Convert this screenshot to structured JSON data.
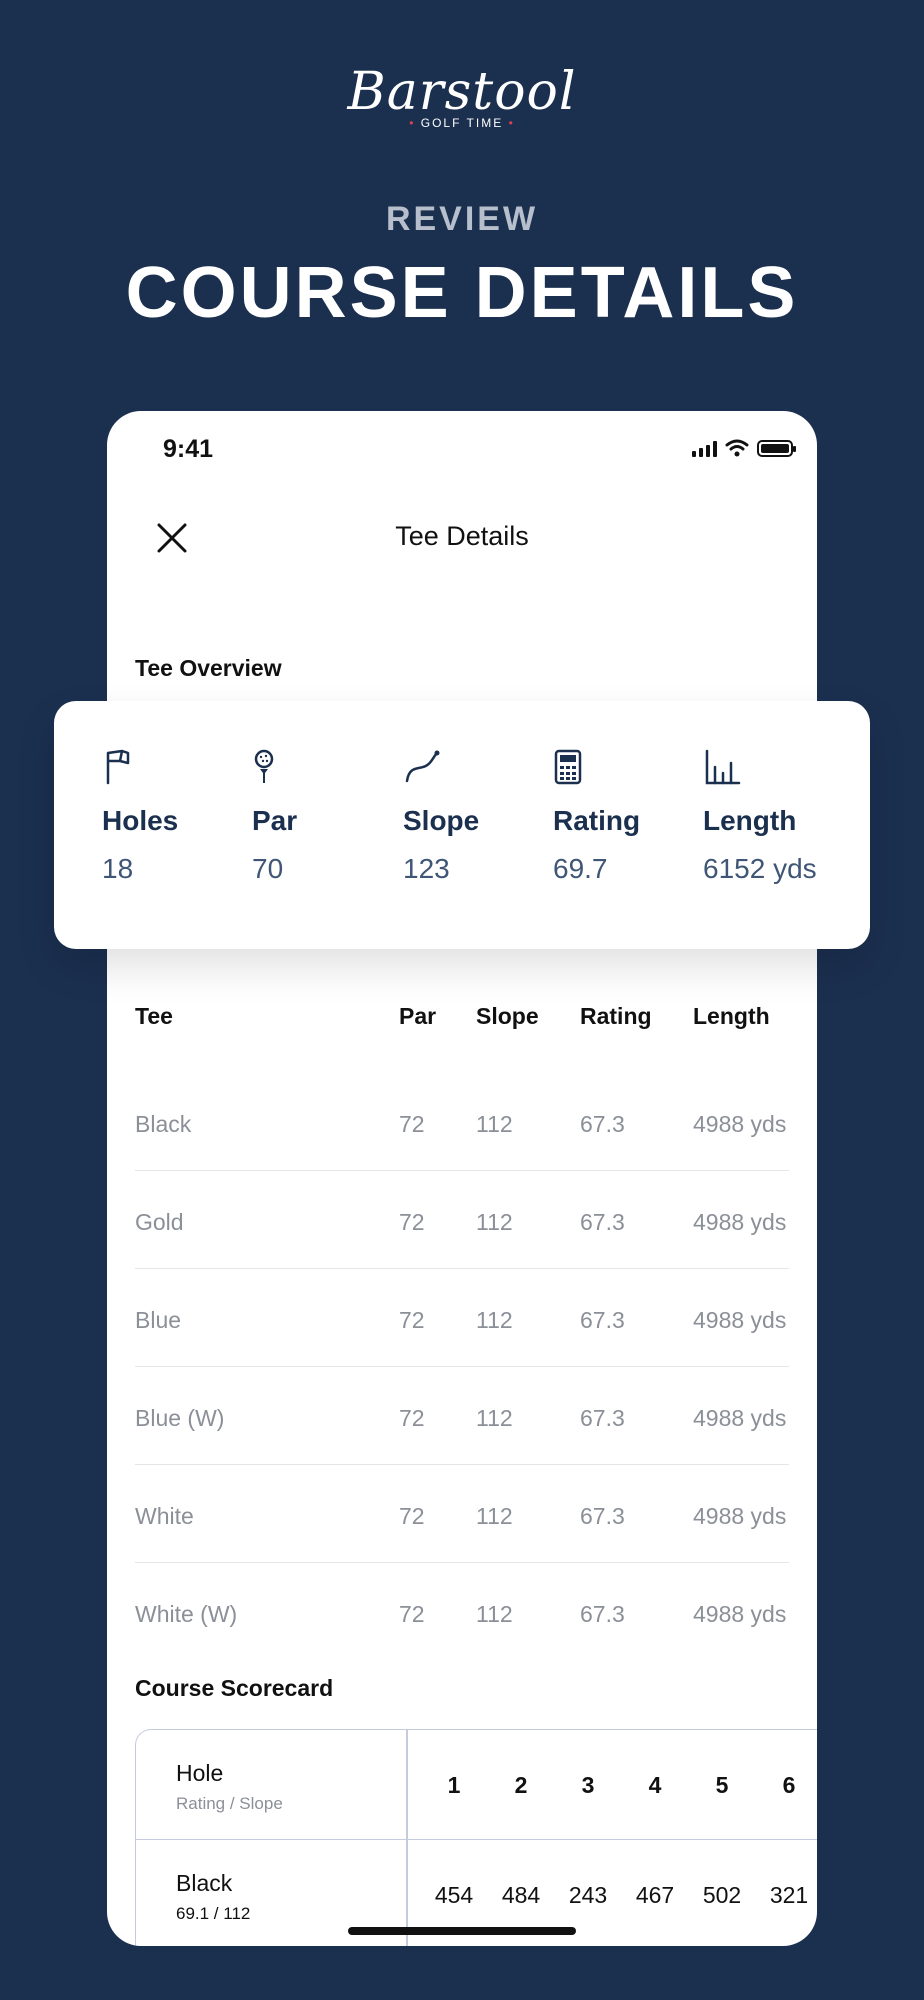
{
  "brand": {
    "script": "Barstool",
    "sub": "GOLF TIME"
  },
  "promo": {
    "eyebrow": "REVIEW",
    "headline": "COURSE DETAILS"
  },
  "status_bar": {
    "time": "9:41"
  },
  "nav": {
    "title": "Tee Details",
    "close_icon": "close-icon"
  },
  "sections": {
    "overview": "Tee Overview",
    "scorecard": "Course Scorecard"
  },
  "overview": [
    {
      "icon": "flag-icon",
      "label": "Holes",
      "value": "18"
    },
    {
      "icon": "golf-ball-tee-icon",
      "label": "Par",
      "value": "70"
    },
    {
      "icon": "slope-curve-icon",
      "label": "Slope",
      "value": "123"
    },
    {
      "icon": "calculator-icon",
      "label": "Rating",
      "value": "69.7"
    },
    {
      "icon": "bar-chart-icon",
      "label": "Length",
      "value": "6152 yds"
    }
  ],
  "tee_table": {
    "headers": {
      "tee": "Tee",
      "par": "Par",
      "slope": "Slope",
      "rating": "Rating",
      "length": "Length"
    },
    "rows": [
      {
        "tee": "Black",
        "par": "72",
        "slope": "112",
        "rating": "67.3",
        "length": "4988 yds"
      },
      {
        "tee": "Gold",
        "par": "72",
        "slope": "112",
        "rating": "67.3",
        "length": "4988 yds"
      },
      {
        "tee": "Blue",
        "par": "72",
        "slope": "112",
        "rating": "67.3",
        "length": "4988 yds"
      },
      {
        "tee": "Blue (W)",
        "par": "72",
        "slope": "112",
        "rating": "67.3",
        "length": "4988 yds"
      },
      {
        "tee": "White",
        "par": "72",
        "slope": "112",
        "rating": "67.3",
        "length": "4988 yds"
      },
      {
        "tee": "White (W)",
        "par": "72",
        "slope": "112",
        "rating": "67.3",
        "length": "4988 yds"
      }
    ]
  },
  "scorecard": {
    "header": {
      "label": "Hole",
      "sub": "Rating / Slope",
      "holes": [
        "1",
        "2",
        "3",
        "4",
        "5",
        "6"
      ]
    },
    "rows": [
      {
        "label": "Black",
        "sub": "69.1 / 112",
        "yards": [
          "454",
          "484",
          "243",
          "467",
          "502",
          "321"
        ]
      }
    ]
  },
  "colors": {
    "background": "#1b2f4f",
    "card": "#ffffff",
    "accent_text": "#3f5676",
    "muted": "#8b8f97"
  }
}
